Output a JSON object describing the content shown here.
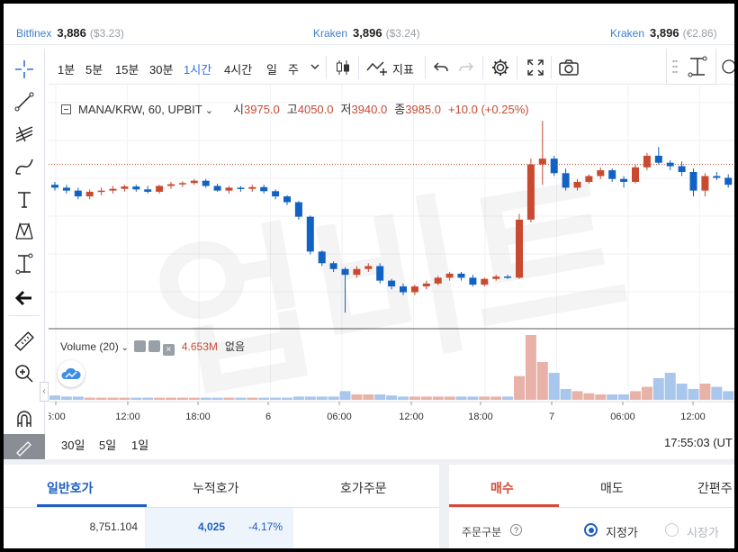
{
  "ticker": [
    {
      "exchange": "Bitfinex",
      "price": "3,886",
      "sub": "($3.23)"
    },
    {
      "exchange": "Kraken",
      "price": "3,896",
      "sub": "($3.24)"
    },
    {
      "exchange": "Kraken",
      "price": "3,896",
      "sub": "(€2.86)"
    }
  ],
  "toolbar": {
    "intervals": [
      "1분",
      "5분",
      "15분",
      "30분",
      "1시간",
      "4시간",
      "일",
      "주"
    ],
    "active_interval": "1시간",
    "indicator_label": "지표"
  },
  "chart_header": {
    "symbol": "MANA/KRW, 60, UPBIT",
    "open_label": "시",
    "open": "3975.0",
    "high_label": "고",
    "high": "4050.0",
    "low_label": "저",
    "low": "3940.0",
    "close_label": "종",
    "close": "3985.0",
    "change": "+10.0 (+0.25%)"
  },
  "volume_header": {
    "label": "Volume (20)",
    "value": "4.653M",
    "ma": "없음"
  },
  "watermark": "업비트",
  "colors": {
    "up": "#c84a31",
    "down": "#1261c4",
    "up_vol": "#e8b2a8",
    "down_vol": "#a9c6ec",
    "accent": "#2f6ede"
  },
  "chart_data": {
    "type": "candlestick",
    "x_labels": [
      "6:00",
      "12:00",
      "18:00",
      "6",
      "06:00",
      "12:00",
      "18:00",
      "7",
      "06:00",
      "12:00"
    ],
    "price_range": [
      3700,
      4100
    ],
    "reference_price": 3975,
    "candles": [
      [
        3940,
        3945,
        3930,
        3935
      ],
      [
        3935,
        3940,
        3925,
        3930
      ],
      [
        3930,
        3935,
        3915,
        3920
      ],
      [
        3920,
        3932,
        3915,
        3928
      ],
      [
        3928,
        3935,
        3922,
        3930
      ],
      [
        3930,
        3938,
        3925,
        3933
      ],
      [
        3933,
        3940,
        3928,
        3937
      ],
      [
        3937,
        3940,
        3928,
        3932
      ],
      [
        3932,
        3938,
        3925,
        3928
      ],
      [
        3928,
        3940,
        3925,
        3938
      ],
      [
        3938,
        3945,
        3933,
        3941
      ],
      [
        3941,
        3946,
        3936,
        3943
      ],
      [
        3943,
        3950,
        3940,
        3947
      ],
      [
        3947,
        3950,
        3935,
        3938
      ],
      [
        3938,
        3942,
        3928,
        3930
      ],
      [
        3930,
        3938,
        3925,
        3935
      ],
      [
        3935,
        3938,
        3928,
        3933
      ],
      [
        3933,
        3940,
        3928,
        3936
      ],
      [
        3936,
        3940,
        3925,
        3929
      ],
      [
        3929,
        3932,
        3915,
        3920
      ],
      [
        3920,
        3922,
        3905,
        3910
      ],
      [
        3910,
        3912,
        3880,
        3885
      ],
      [
        3885,
        3887,
        3820,
        3825
      ],
      [
        3825,
        3827,
        3800,
        3805
      ],
      [
        3805,
        3808,
        3790,
        3795
      ],
      [
        3795,
        3798,
        3720,
        3785
      ],
      [
        3785,
        3800,
        3780,
        3795
      ],
      [
        3795,
        3805,
        3790,
        3800
      ],
      [
        3800,
        3805,
        3770,
        3775
      ],
      [
        3775,
        3778,
        3760,
        3765
      ],
      [
        3765,
        3770,
        3750,
        3755
      ],
      [
        3755,
        3768,
        3750,
        3765
      ],
      [
        3765,
        3775,
        3760,
        3770
      ],
      [
        3770,
        3783,
        3767,
        3780
      ],
      [
        3780,
        3790,
        3775,
        3787
      ],
      [
        3787,
        3790,
        3775,
        3780
      ],
      [
        3780,
        3785,
        3765,
        3768
      ],
      [
        3768,
        3780,
        3765,
        3778
      ],
      [
        3778,
        3785,
        3775,
        3782
      ],
      [
        3782,
        3785,
        3778,
        3780
      ],
      [
        3780,
        3890,
        3778,
        3880
      ],
      [
        3880,
        3985,
        3875,
        3975
      ],
      [
        3975,
        4050,
        3940,
        3985
      ],
      [
        3985,
        3990,
        3955,
        3960
      ],
      [
        3960,
        3968,
        3930,
        3935
      ],
      [
        3935,
        3950,
        3930,
        3945
      ],
      [
        3945,
        3958,
        3942,
        3955
      ],
      [
        3955,
        3970,
        3950,
        3965
      ],
      [
        3965,
        3968,
        3945,
        3950
      ],
      [
        3950,
        3955,
        3935,
        3945
      ],
      [
        3945,
        3975,
        3942,
        3970
      ],
      [
        3970,
        3995,
        3965,
        3990
      ],
      [
        3990,
        4005,
        3975,
        3978
      ],
      [
        3978,
        3982,
        3965,
        3972
      ],
      [
        3972,
        3980,
        3955,
        3962
      ],
      [
        3962,
        3968,
        3920,
        3930
      ],
      [
        3930,
        3960,
        3920,
        3955
      ],
      [
        3955,
        3962,
        3948,
        3952
      ],
      [
        3952,
        3958,
        3935,
        3940
      ]
    ],
    "volumes": [
      4,
      3,
      3,
      2,
      2,
      2,
      2,
      2,
      2,
      2,
      2,
      2,
      2,
      2,
      2,
      2,
      2,
      2,
      2,
      2,
      2,
      3,
      3,
      3,
      3,
      8,
      5,
      5,
      5,
      4,
      3,
      3,
      3,
      3,
      3,
      3,
      3,
      3,
      3,
      3,
      22,
      60,
      35,
      25,
      10,
      8,
      6,
      5,
      5,
      5,
      8,
      12,
      20,
      25,
      15,
      10,
      15,
      12,
      8
    ]
  },
  "bottom": {
    "ranges": [
      "30일",
      "5일",
      "1일"
    ],
    "time": "17:55:03 (UT"
  },
  "orderbook": {
    "tabs": [
      "일반호가",
      "누적호가",
      "호가주문"
    ],
    "row_qty": "8,751.104",
    "row_price": "4,025",
    "row_pct": "-4.17%"
  },
  "trade": {
    "tabs": [
      "매수",
      "매도",
      "간편주"
    ],
    "order_type_label": "주문구분",
    "limit": "지정가",
    "market": "시장가"
  }
}
